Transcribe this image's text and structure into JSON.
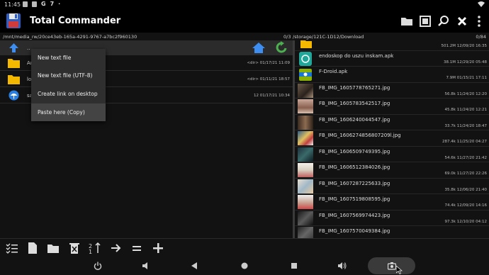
{
  "status_bar": {
    "time": "11:45",
    "status_icons": [
      "photo-icon",
      "photo-icon",
      "g-icon",
      "seven-icon",
      "dots-icon"
    ],
    "g_letter": "G",
    "seven": "7",
    "more": "·"
  },
  "title_bar": {
    "title": "Total Commander",
    "actions": [
      "folder-icon",
      "windows-icon",
      "search-icon",
      "close-icon",
      "more-icon"
    ]
  },
  "left_panel": {
    "path": "/mnt/media_rw/20ce43eb-165a-4291-9767-a7bc2f960130",
    "count": "0/3",
    "header_name": "..",
    "rows": [
      {
        "name": "An",
        "meta": "<dir>  01/17/21  11:09",
        "icon": "folder-icon"
      },
      {
        "name": "los",
        "meta": "<dir>  01/11/21  18:57",
        "icon": "folder-icon"
      },
      {
        "name": "sa",
        "meta": "12  01/17/21  10:34",
        "icon": "umbrella-icon"
      }
    ]
  },
  "right_panel": {
    "path": "/storage/121C-1D12/Download",
    "count": "0/84",
    "rows": [
      {
        "name": "",
        "meta": "501.2M  12/09/20  16:35",
        "thumb": "folder-icon"
      },
      {
        "name": "endoskop do uszu inskam.apk",
        "meta": "38.1M  12/29/20  05:48",
        "thumb": "apk-icon"
      },
      {
        "name": "F-Droid.apk",
        "meta": "7.9M  01/15/21  17:11",
        "thumb": "fdroid-icon"
      },
      {
        "name": "FB_IMG_1605778765271.jpg",
        "meta": "56.8k  11/24/20  12:20",
        "thumb": "image-thumb"
      },
      {
        "name": "FB_IMG_1605783542517.jpg",
        "meta": "45.8k  11/24/20  12:21",
        "thumb": "image-thumb"
      },
      {
        "name": "FB_IMG_1606240044547.jpg",
        "meta": "33.7k  11/24/20  18:47",
        "thumb": "image-thumb"
      },
      {
        "name": "FB_IMG_1606274856807209l.jpg",
        "meta": "287.4k  11/25/20  04:27",
        "thumb": "image-thumb"
      },
      {
        "name": "FB_IMG_1606509749395.jpg",
        "meta": "54.6k  11/27/20  21:42",
        "thumb": "image-thumb"
      },
      {
        "name": "FB_IMG_1606512384026.jpg",
        "meta": "69.0k  11/27/20  22:26",
        "thumb": "image-thumb"
      },
      {
        "name": "FB_IMG_1607287225633.jpg",
        "meta": "35.8k  12/06/20  21:40",
        "thumb": "image-thumb"
      },
      {
        "name": "FB_IMG_1607519808595.jpg",
        "meta": "74.4k  12/09/20  14:16",
        "thumb": "image-thumb"
      },
      {
        "name": "FB_IMG_1607569974423.jpg",
        "meta": "97.3k  12/10/20  04:12",
        "thumb": "image-thumb"
      },
      {
        "name": "FB_IMG_1607570049384.jpg",
        "meta": "",
        "thumb": "image-thumb"
      }
    ]
  },
  "context_menu": {
    "items": [
      "New text file",
      "New text file (UTF-8)",
      "Create link on desktop",
      "Paste here (Copy)"
    ]
  },
  "toolbar": {
    "buttons": [
      "select-icon",
      "file-icon",
      "folder-icon",
      "delete-icon",
      "sort-icon",
      "arrow-right-icon",
      "equals-icon",
      "plus-icon"
    ]
  },
  "nav_bar": {
    "buttons": [
      "power-icon",
      "volume-down-icon",
      "back-icon",
      "home-icon",
      "recents-icon",
      "volume-up-icon",
      "screenshot-icon"
    ]
  },
  "colors": {
    "accent_blue": "#3d8ef0",
    "accent_green": "#4caf50",
    "folder_yellow": "#f5b800",
    "background": "#121212"
  }
}
